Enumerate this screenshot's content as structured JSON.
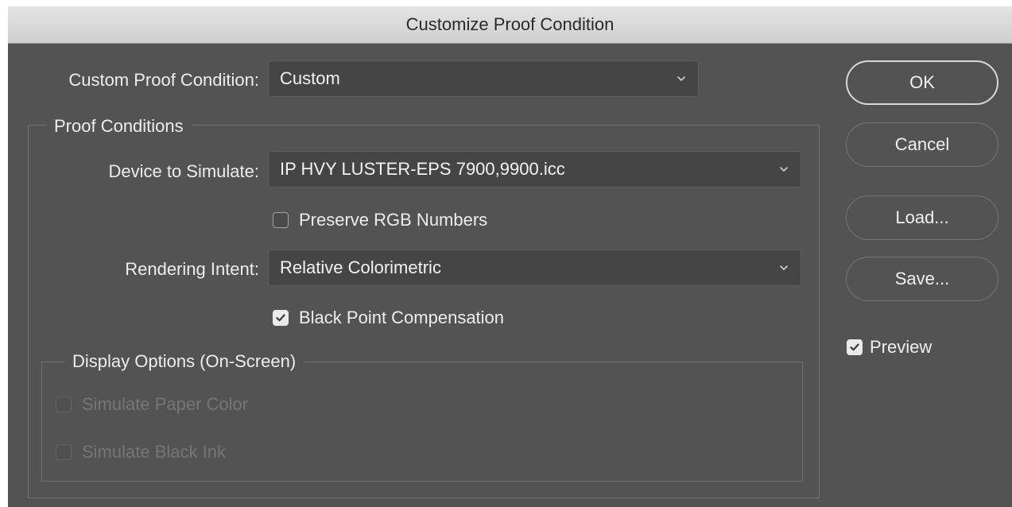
{
  "window": {
    "title": "Customize Proof Condition"
  },
  "custom_proof_condition": {
    "label": "Custom Proof Condition:",
    "value": "Custom"
  },
  "proof_conditions": {
    "group_title": "Proof Conditions",
    "device_label": "Device to Simulate:",
    "device_value": "IP HVY LUSTER-EPS 7900,9900.icc",
    "preserve_rgb": {
      "label": "Preserve RGB Numbers",
      "checked": false
    },
    "rendering_label": "Rendering Intent:",
    "rendering_value": "Relative Colorimetric",
    "black_point": {
      "label": "Black Point Compensation",
      "checked": true
    }
  },
  "display_options": {
    "group_title": "Display Options (On-Screen)",
    "simulate_paper": {
      "label": "Simulate Paper Color",
      "checked": false,
      "enabled": false
    },
    "simulate_ink": {
      "label": "Simulate Black Ink",
      "checked": false,
      "enabled": false
    }
  },
  "buttons": {
    "ok": "OK",
    "cancel": "Cancel",
    "load": "Load...",
    "save": "Save..."
  },
  "preview": {
    "label": "Preview",
    "checked": true
  },
  "colors": {
    "dialog_bg": "#535353",
    "field_bg": "#454545",
    "text": "#ededed",
    "disabled_text": "#767676"
  }
}
